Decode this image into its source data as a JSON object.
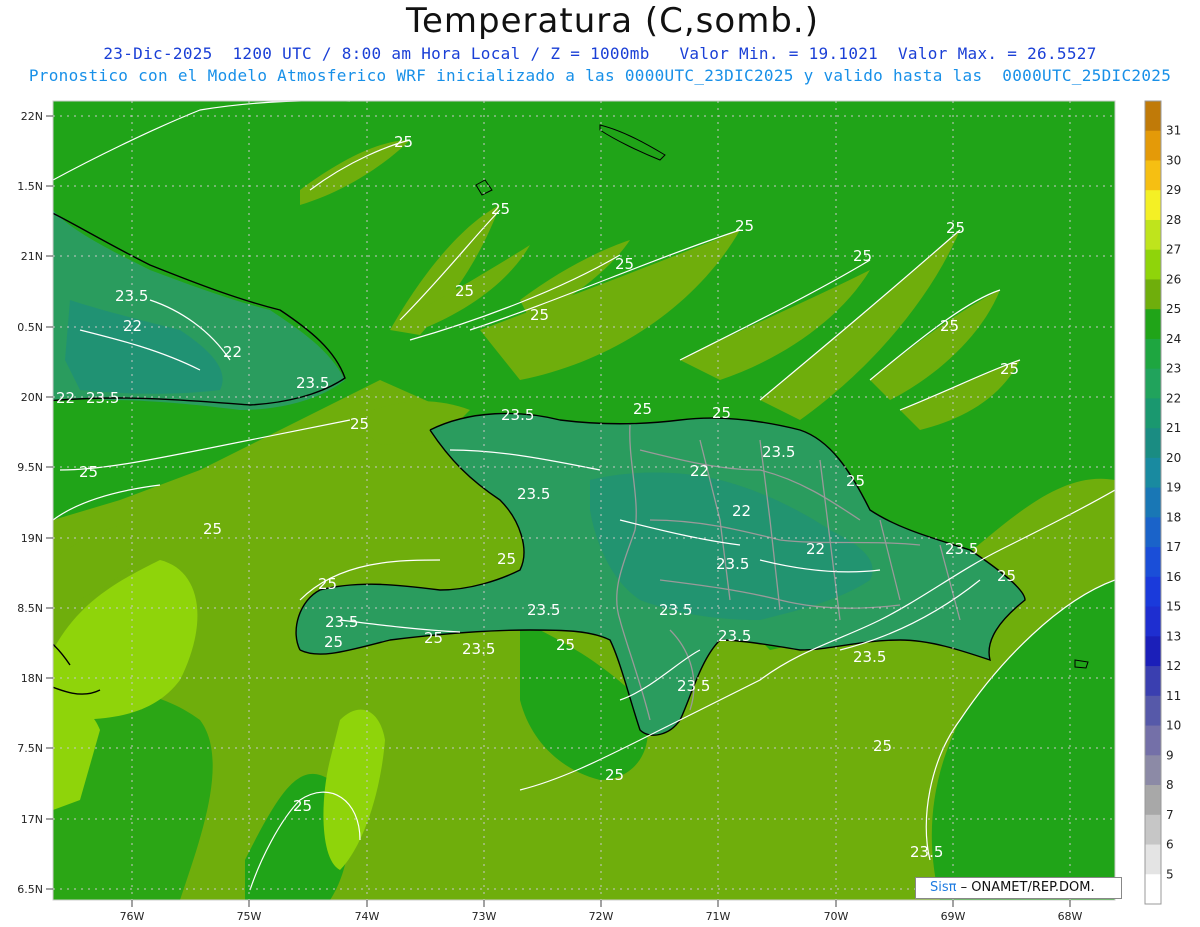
{
  "header": {
    "title": "Temperatura (C,somb.)",
    "line1": "23-Dic-2025  1200 UTC / 8:00 am Hora Local / Z = 1000mb   Valor Min. = 19.1021  Valor Max. = 26.5527",
    "line2": "Pronostico con el Modelo Atmosferico WRF inicializado a las 0000UTC_23DIC2025 y valido hasta las  0000UTC_25DIC2025"
  },
  "map": {
    "lat_ticks": [
      "22N",
      "1.5N",
      "21N",
      "0.5N",
      "20N",
      "9.5N",
      "19N",
      "8.5N",
      "18N",
      "7.5N",
      "17N",
      "6.5N"
    ],
    "lon_ticks": [
      "76W",
      "75W",
      "74W",
      "73W",
      "72W",
      "71W",
      "70W",
      "69W",
      "68W"
    ],
    "contour_labels": [
      {
        "text": "25"
      },
      {
        "text": "25"
      },
      {
        "text": "25"
      },
      {
        "text": "25"
      },
      {
        "text": "25"
      },
      {
        "text": "25"
      },
      {
        "text": "25"
      },
      {
        "text": "25"
      },
      {
        "text": "25"
      },
      {
        "text": "25"
      },
      {
        "text": "25"
      },
      {
        "text": "25"
      },
      {
        "text": "25"
      },
      {
        "text": "25"
      },
      {
        "text": "25"
      },
      {
        "text": "25"
      },
      {
        "text": "25"
      },
      {
        "text": "25"
      },
      {
        "text": "25"
      },
      {
        "text": "25"
      },
      {
        "text": "25"
      },
      {
        "text": "25"
      },
      {
        "text": "25"
      },
      {
        "text": "25"
      },
      {
        "text": "25"
      },
      {
        "text": "23.5"
      },
      {
        "text": "22"
      },
      {
        "text": "22"
      },
      {
        "text": "23.5"
      },
      {
        "text": "22"
      },
      {
        "text": "23.5"
      },
      {
        "text": "23.5"
      },
      {
        "text": "23.5"
      },
      {
        "text": "23.5"
      },
      {
        "text": "22"
      },
      {
        "text": "22"
      },
      {
        "text": "22"
      },
      {
        "text": "23.5"
      },
      {
        "text": "23.5"
      },
      {
        "text": "23.5"
      },
      {
        "text": "23.5"
      },
      {
        "text": "23.5"
      },
      {
        "text": "23.5"
      },
      {
        "text": "23.5"
      },
      {
        "text": "23.5"
      },
      {
        "text": "23.5"
      },
      {
        "text": "23.5"
      }
    ]
  },
  "colorbar": {
    "labels": [
      "31",
      "30",
      "29",
      "28",
      "27",
      "26",
      "25",
      "24",
      "23",
      "22",
      "21",
      "20",
      "19",
      "18",
      "17",
      "16",
      "15",
      "13",
      "12",
      "11",
      "10",
      "9",
      "8",
      "7",
      "6",
      "5"
    ],
    "colors": [
      "#c07a08",
      "#e49a08",
      "#f6bf12",
      "#f4f025",
      "#bfe41c",
      "#8fd40a",
      "#6fae0c",
      "#20a418",
      "#1ea640",
      "#21a35c",
      "#1a986f",
      "#1a8c82",
      "#198aa0",
      "#1977b5",
      "#1a63c9",
      "#1a4ed8",
      "#1a3adb",
      "#1e2ed0",
      "#1b1fb9",
      "#3a3fb0",
      "#5659a9",
      "#7470a8",
      "#8c8aa6",
      "#a8a8a8",
      "#c6c6c6",
      "#e4e4e4",
      "#ffffff"
    ]
  },
  "credit": {
    "brand": "Sisπ",
    "rest": "– ONAMET/REP.DOM."
  },
  "colors": {
    "ocean_warm": "#6fae0c",
    "land_cool": "#1fa23d",
    "land_cooler": "#2a9c5e",
    "hot": "#8fd40a"
  }
}
